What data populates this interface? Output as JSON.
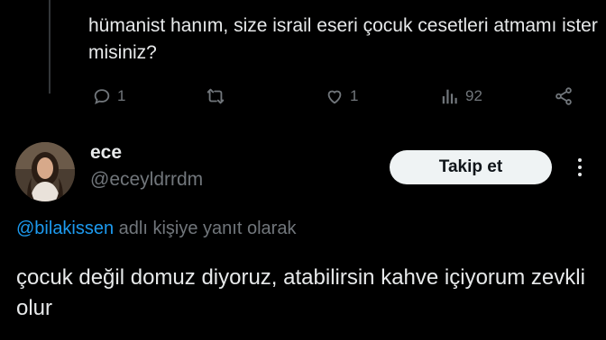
{
  "parent_tweet": {
    "text": "hümanist hanım, size israil eseri çocuk cesetleri atmamı ister misiniz?",
    "actions": {
      "reply_count": "1",
      "retweet_count": "",
      "like_count": "1",
      "view_count": "92"
    }
  },
  "reply_tweet": {
    "author_name": "ece",
    "author_handle": "@eceyldrrdm",
    "follow_label": "Takip et",
    "reply_to_mention": "@bilakissen",
    "reply_to_suffix": " adlı kişiye yanıt olarak",
    "text": "çocuk değil domuz diyoruz, atabilirsin kahve içiyorum zevkli olur"
  },
  "colors": {
    "background": "#000000",
    "text_primary": "#e7e9ea",
    "text_secondary": "#71767b",
    "link": "#1d9bf0",
    "button_bg": "#eff3f4"
  },
  "icons": {
    "reply": "reply-icon",
    "retweet": "retweet-icon",
    "like": "heart-icon",
    "views": "views-chart-icon",
    "share": "share-icon",
    "more": "more-dots-icon"
  }
}
